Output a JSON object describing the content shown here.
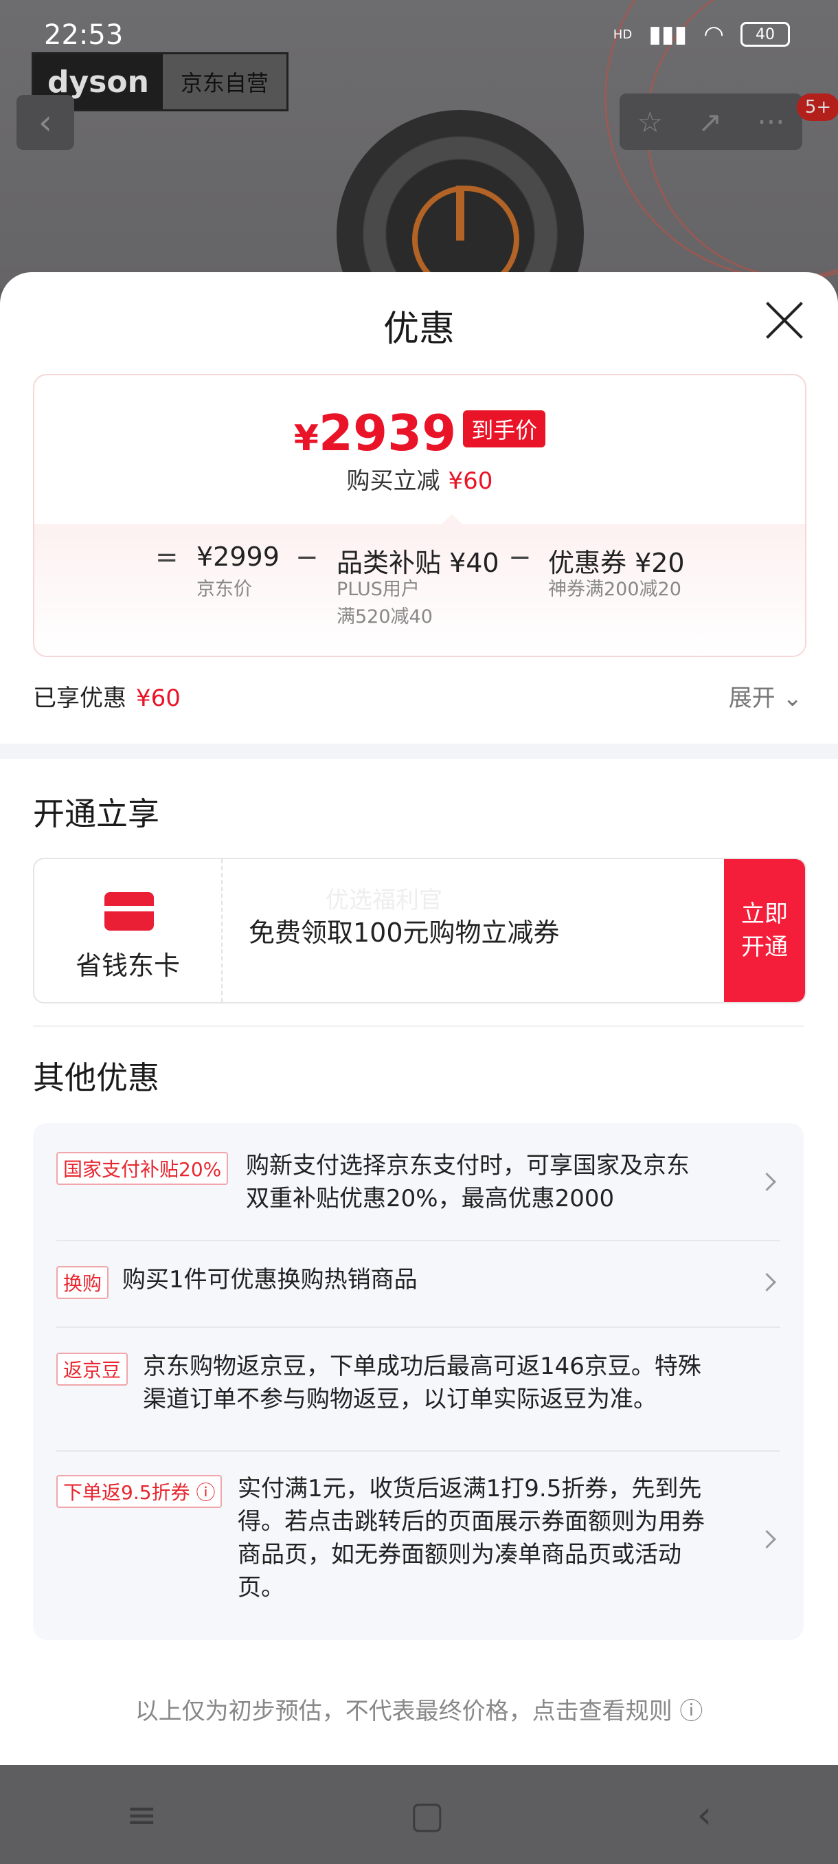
{
  "status_bar": {
    "time": "22:53",
    "battery": "40",
    "network": "HD"
  },
  "background": {
    "brand_logo": "dyson",
    "brand_tag": "京东自营",
    "cart_badge": "5+"
  },
  "sheet": {
    "title": "优惠"
  },
  "price": {
    "currency": "¥",
    "final_price": "2939",
    "final_label": "到手价",
    "reduce_label": "购买立减",
    "reduce_value": "¥60",
    "breakdown": {
      "eq": "=",
      "minus": "−",
      "base_value": "¥2999",
      "base_label": "京东价",
      "subsidy_value": "品类补贴 ¥40",
      "subsidy_line1": "PLUS用户",
      "subsidy_line2": "满520减40",
      "coupon_value": "优惠券 ¥20",
      "coupon_label": "神券满200减20"
    }
  },
  "enjoyed": {
    "label": "已享优惠",
    "value": "¥60",
    "expand": "展开"
  },
  "open_section": {
    "title": "开通立享",
    "card_name": "省钱东卡",
    "watermark": "优选福利官",
    "desc": "免费领取100元购物立减券",
    "button_line1": "立即",
    "button_line2": "开通"
  },
  "other_section": {
    "title": "其他优惠",
    "items": [
      {
        "tag": "国家支付补贴20%",
        "line1": "购新支付选择京东支付时，可享国家及京东",
        "line2": "双重补贴优惠20%，最高优惠2000"
      },
      {
        "tag": "换购",
        "line1": "购买1件可优惠换购热销商品"
      },
      {
        "tag": "返京豆",
        "line1": "京东购物返京豆，下单成功后最高可返146京豆。特殊",
        "line2": "渠道订单不参与购物返豆，以订单实际返豆为准。"
      },
      {
        "tag": "下单返9.5折券",
        "line1": "实付满1元，收货后返满1打9.5折券，先到先",
        "line2": "得。若点击跳转后的页面展示券面额则为用券",
        "line3": "商品页，如无券面额则为凑单商品页或活动",
        "line4": "页。"
      }
    ]
  },
  "footer": {
    "note": "以上仅为初步预估，不代表最终价格，点击查看规则"
  },
  "icons": {
    "back": "‹",
    "star": "☆",
    "share": "↗",
    "more": "···",
    "chevron_down": "⌄",
    "info": "ⓘ",
    "nav_menu": "≡",
    "nav_home": "▢",
    "nav_back": "‹"
  },
  "colors": {
    "accent_red": "#ea1428",
    "button_red": "#f41d3a",
    "panel_bg": "#f6f7fb"
  }
}
